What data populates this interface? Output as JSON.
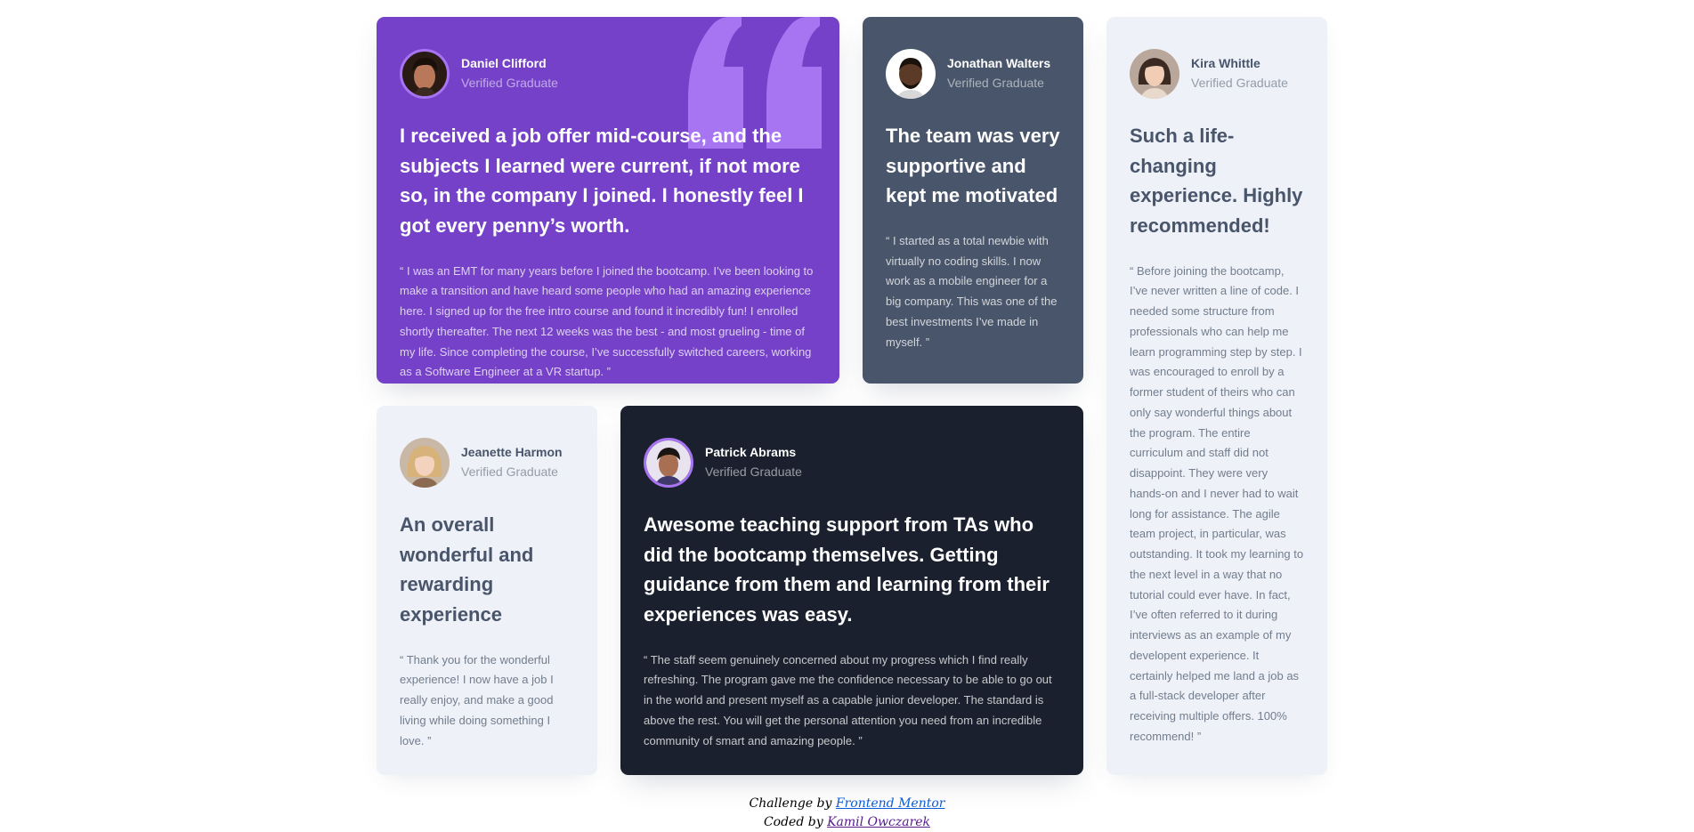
{
  "testimonials": [
    {
      "name": "Daniel Clifford",
      "role": "Verified Graduate",
      "headline": "I received a job offer mid-course, and the subjects I learned were current, if not more so, in the company I joined. I honestly feel I got every penny’s worth.",
      "body": "“ I was an EMT for many years before I joined the bootcamp. I’ve been looking to make a transition and have heard some people who had an amazing experience here. I signed up for the free intro course and found it incredibly fun! I enrolled shortly thereafter. The next 12 weeks was the best - and most grueling - time of my life. Since completing the course, I’ve successfully switched careers, working as a Software Engineer at a VR startup. ”"
    },
    {
      "name": "Jonathan Walters",
      "role": "Verified Graduate",
      "headline": "The team was very supportive and kept me motivated",
      "body": "“ I started as a total newbie with virtually no coding skills. I now work as a mobile engineer for a big company. This was one of the best investments I’ve made in myself. ”"
    },
    {
      "name": "Kira Whittle",
      "role": "Verified Graduate",
      "headline": "Such a life-changing experience. Highly recommended!",
      "body": "“ Before joining the bootcamp, I’ve never written a line of code. I needed some structure from professionals who can help me learn programming step by step. I was encouraged to enroll by a former student of theirs who can only say wonderful things about the program. The entire curriculum and staff did not disappoint. They were very hands-on and I never had to wait long for assistance. The agile team project, in particular, was outstanding. It took my learning to the next level in a way that no tutorial could ever have. In fact, I’ve often referred to it during interviews as an example of my developent experience. It certainly helped me land a job as a full-stack developer after receiving multiple offers. 100% recommend! ”"
    },
    {
      "name": "Jeanette Harmon",
      "role": "Verified Graduate",
      "headline": "An overall wonderful and rewarding experience",
      "body": "“ Thank you for the wonderful experience! I now have a job I really enjoy, and make a good living while doing something I love. ”"
    },
    {
      "name": "Patrick Abrams",
      "role": "Verified Graduate",
      "headline": "Awesome teaching support from TAs who did the bootcamp themselves. Getting guidance from them and learning from their experiences was easy.",
      "body": "“ The staff seem genuinely concerned about my progress which I find really refreshing. The program gave me the confidence necessary to be able to go out in the world and present myself as a capable junior developer. The standard is above the rest. You will get the personal attention you need from an incredible community of smart and amazing people. ”"
    }
  ],
  "attribution": {
    "challenge_prefix": "Challenge by",
    "challenge_link": "Frontend Mentor",
    "coded_prefix": "Coded by",
    "coded_link": "Kamil Owczarek"
  },
  "icons": {
    "quote": "quotation-mark-icon"
  },
  "colors": {
    "purple": "#7541c8",
    "slate": "#48556a",
    "light": "#eef1f7",
    "dark": "#1a202d",
    "quote": "#a775f1"
  }
}
